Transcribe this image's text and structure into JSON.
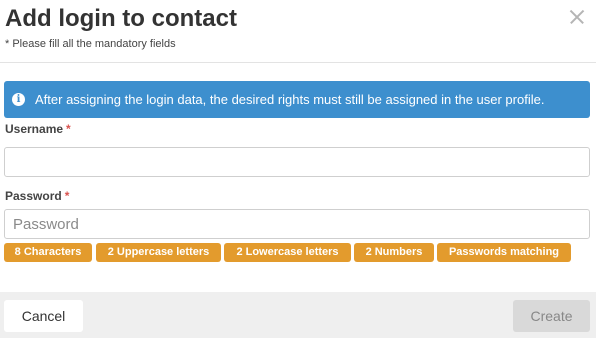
{
  "dialog": {
    "title": "Add login to contact",
    "subtitle": "* Please fill all the mandatory fields",
    "close_icon": "close-icon"
  },
  "info": {
    "icon": "info-icon",
    "icon_glyph": "i",
    "text": "After assigning the login data, the desired rights must still be assigned in the user profile.",
    "color": "#3d8fce"
  },
  "form": {
    "username": {
      "label": "Username",
      "required_mark": "*",
      "value": "",
      "placeholder": ""
    },
    "password": {
      "label": "Password",
      "required_mark": "*",
      "value": "",
      "placeholder": "Password"
    }
  },
  "password_rules": {
    "badge_color": "#e39b2d",
    "items": [
      "8 Characters",
      "2 Uppercase letters",
      "2 Lowercase letters",
      "2 Numbers",
      "Passwords matching"
    ]
  },
  "footer": {
    "cancel_label": "Cancel",
    "create_label": "Create",
    "create_enabled": false
  }
}
